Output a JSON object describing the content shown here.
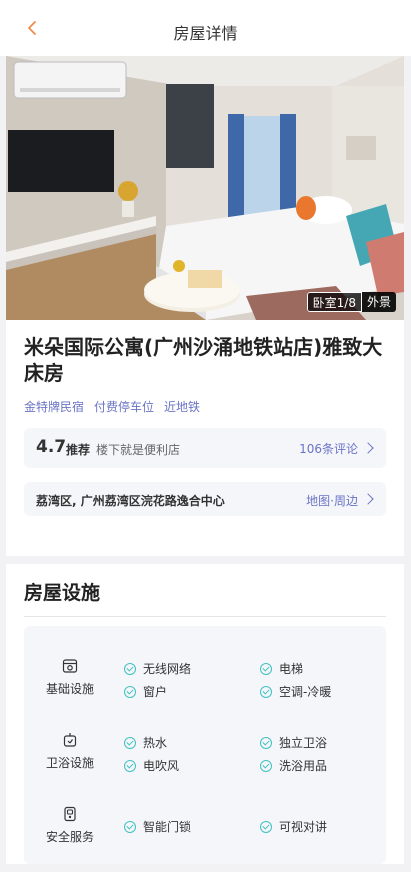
{
  "header": {
    "title": "房屋详情"
  },
  "photo": {
    "counter": "卧室1/8",
    "exterior_label": "外景"
  },
  "hotel": {
    "name": "米朵国际公寓(广州沙涌地铁站店)雅致大床房",
    "tags": [
      "金特牌民宿",
      "付费停车位",
      "近地铁"
    ]
  },
  "rating": {
    "score": "4.7",
    "recommend": "推荐",
    "description": "楼下就是便利店",
    "reviews": "106条评论"
  },
  "address": {
    "text": "荔湾区, 广州荔湾区浣花路逸合中心",
    "map_link": "地图·周边"
  },
  "facilities": {
    "title": "房屋设施",
    "groups": [
      {
        "category": "基础设施",
        "icon": "house-icon",
        "items": [
          "无线网络",
          "电梯",
          "窗户",
          "空调-冷暖"
        ]
      },
      {
        "category": "卫浴设施",
        "icon": "shower-icon",
        "items": [
          "热水",
          "独立卫浴",
          "电吹风",
          "洗浴用品"
        ]
      },
      {
        "category": "安全服务",
        "icon": "smart-lock-icon",
        "items": [
          "智能门锁",
          "可视对讲"
        ]
      }
    ]
  },
  "colors": {
    "accent": "#6b74c6",
    "back_arrow": "#f08a4b",
    "check": "#3fc0c0"
  }
}
